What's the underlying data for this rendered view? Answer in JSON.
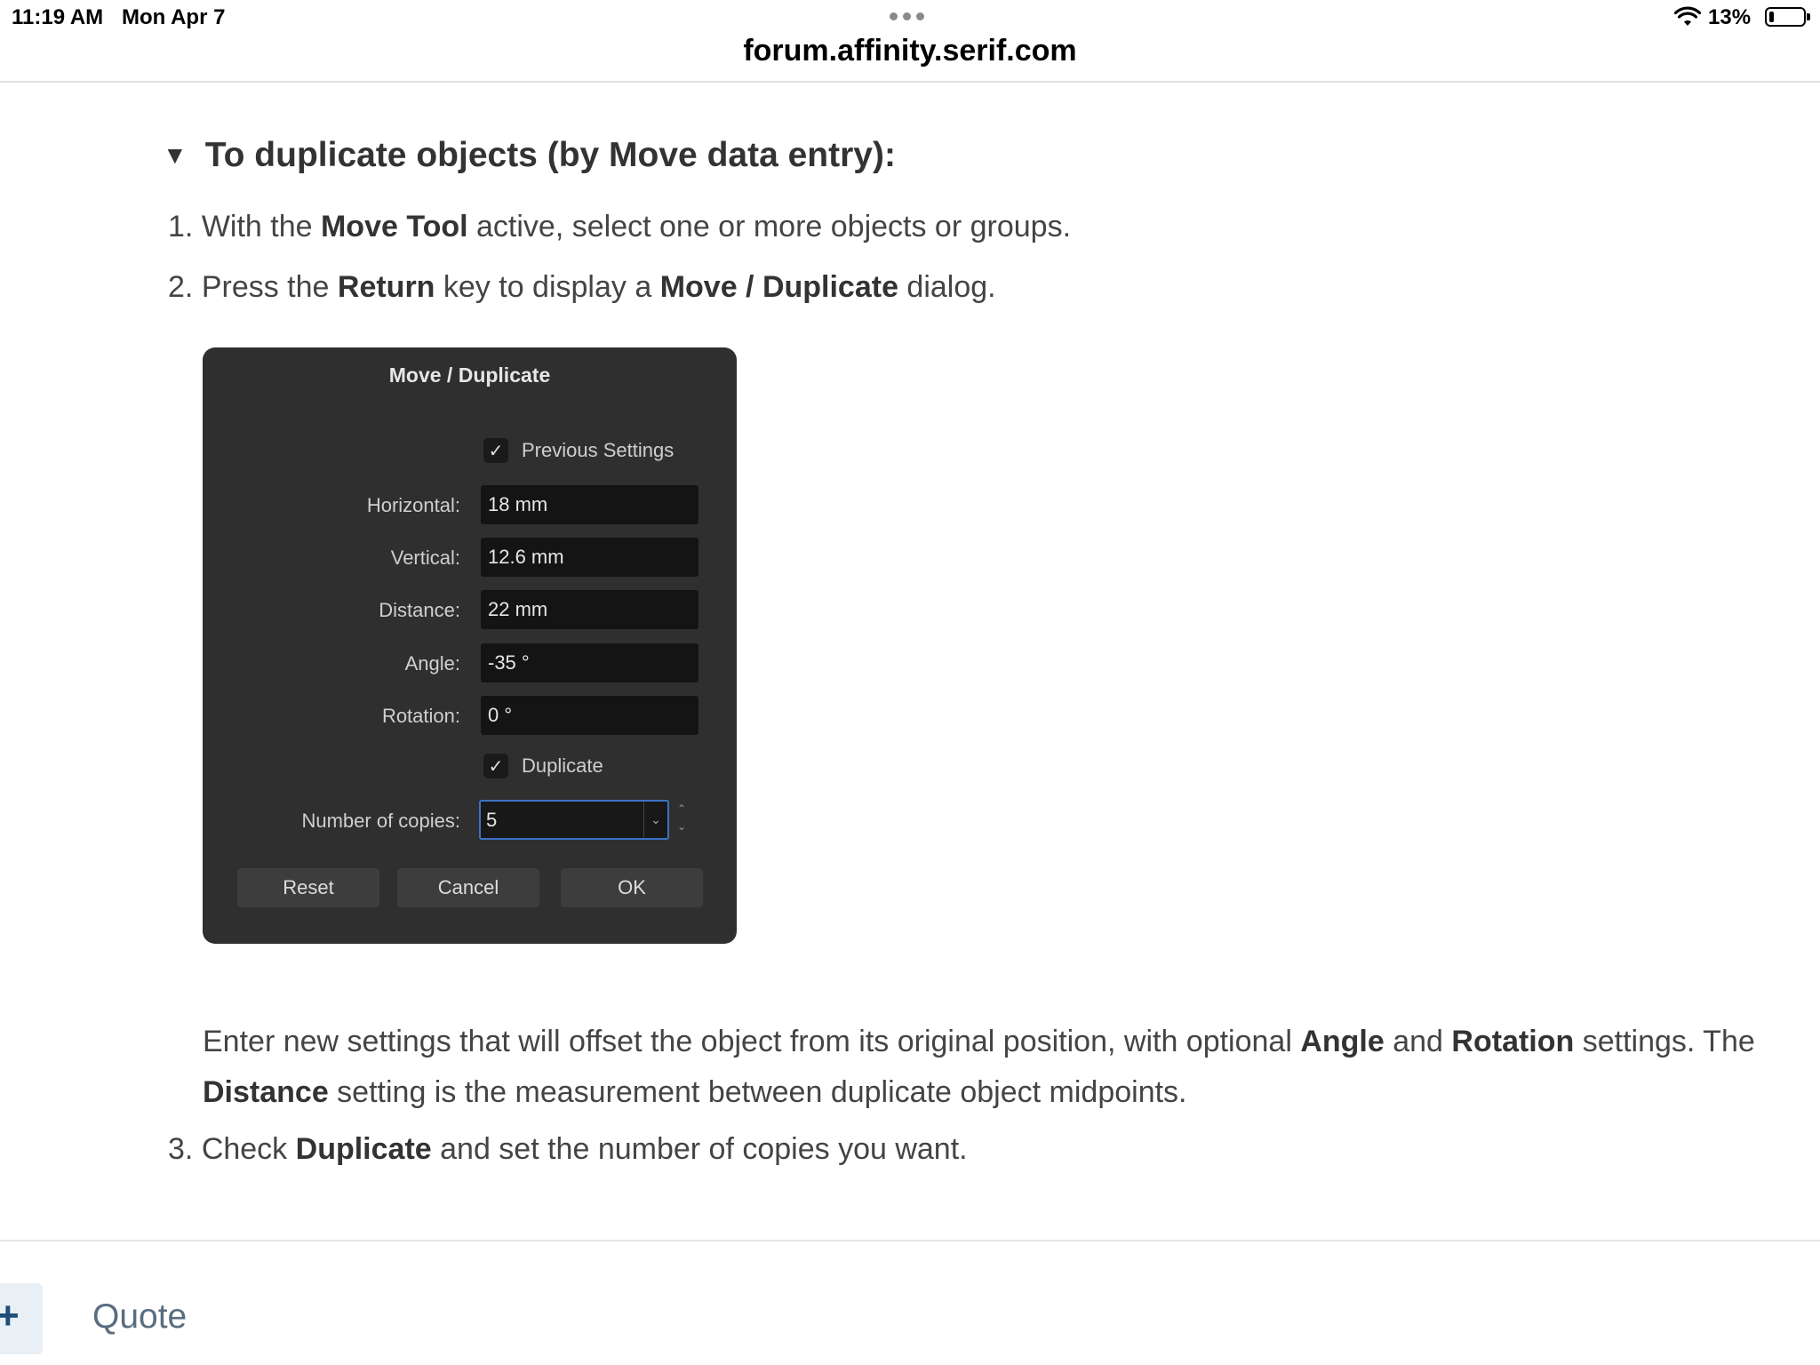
{
  "status_bar": {
    "time": "11:19 AM",
    "date": "Mon Apr 7",
    "battery": "13%"
  },
  "browser": {
    "url": "forum.affinity.serif.com"
  },
  "article": {
    "heading": "To duplicate objects (by Move data entry):",
    "steps": [
      {
        "num": "1.",
        "pre": "With the ",
        "bold1": "Move Tool",
        "post": " active, select one or more objects or groups."
      },
      {
        "num": "2.",
        "pre": "Press the ",
        "bold1": "Return",
        "mid": " key to display a ",
        "bold2": "Move / Duplicate",
        "post": " dialog."
      },
      {
        "num": "3.",
        "pre": "Check ",
        "bold1": "Duplicate",
        "post": " and set the number of copies you want."
      }
    ],
    "paragraph": {
      "t1": "Enter new settings that will offset the object from its original position, with optional ",
      "b1": "Angle",
      "t2": " and ",
      "b2": "Rotation",
      "t3": " settings. The ",
      "b3": "Distance",
      "t4": " setting is the measurement between duplicate object midpoints."
    }
  },
  "dialog": {
    "title": "Move / Duplicate",
    "previous_settings": "Previous Settings",
    "fields": [
      {
        "label": "Horizontal:",
        "value": "18 mm"
      },
      {
        "label": "Vertical:",
        "value": "12.6 mm"
      },
      {
        "label": "Distance:",
        "value": "22 mm"
      },
      {
        "label": "Angle:",
        "value": "-35 °"
      },
      {
        "label": "Rotation:",
        "value": "0 °"
      }
    ],
    "duplicate_label": "Duplicate",
    "copies_label": "Number of copies:",
    "copies_value": "5",
    "buttons": {
      "reset": "Reset",
      "cancel": "Cancel",
      "ok": "OK"
    }
  },
  "footer": {
    "plus": "+",
    "quote": "Quote"
  }
}
